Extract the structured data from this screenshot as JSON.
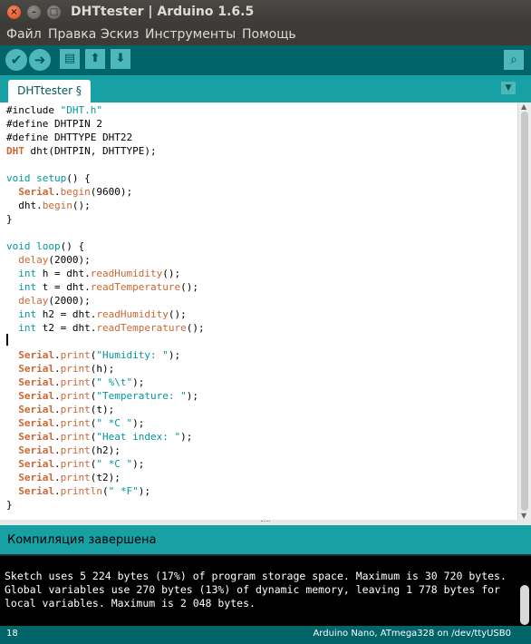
{
  "window": {
    "title": "DHTtester | Arduino 1.6.5",
    "close_glyph": "×",
    "min_glyph": "–",
    "max_glyph": "□"
  },
  "menu": [
    "Файл",
    "Правка",
    "Эскиз",
    "Инструменты",
    "Помощь"
  ],
  "toolbar": {
    "verify_icon": "✔",
    "upload_icon": "➔",
    "new_icon": "▤",
    "open_icon": "⬆",
    "save_icon": "⬇",
    "serial_monitor_icon": "⌕"
  },
  "tab": {
    "label": "DHTtester §",
    "menu_glyph": "▼"
  },
  "editor": {
    "lines": [
      [
        {
          "t": "#include ",
          "c": ""
        },
        {
          "t": "\"DHT.h\"",
          "c": "str"
        }
      ],
      [
        {
          "t": "#define DHTPIN 2",
          "c": ""
        }
      ],
      [
        {
          "t": "#define DHTTYPE DHT22",
          "c": ""
        }
      ],
      [
        {
          "t": "DHT",
          "c": "cls"
        },
        {
          "t": " dht(DHTPIN, DHTTYPE);",
          "c": ""
        }
      ],
      [],
      [
        {
          "t": "void",
          "c": "ty"
        },
        {
          "t": " ",
          "c": ""
        },
        {
          "t": "setup",
          "c": "ty"
        },
        {
          "t": "() {",
          "c": ""
        }
      ],
      [
        {
          "t": "  ",
          "c": ""
        },
        {
          "t": "Serial",
          "c": "cls"
        },
        {
          "t": ".",
          "c": ""
        },
        {
          "t": "begin",
          "c": "fn"
        },
        {
          "t": "(9600);",
          "c": ""
        }
      ],
      [
        {
          "t": "  dht.",
          "c": ""
        },
        {
          "t": "begin",
          "c": "fn"
        },
        {
          "t": "();",
          "c": ""
        }
      ],
      [
        {
          "t": "}",
          "c": ""
        }
      ],
      [],
      [
        {
          "t": "void",
          "c": "ty"
        },
        {
          "t": " ",
          "c": ""
        },
        {
          "t": "loop",
          "c": "ty"
        },
        {
          "t": "() {",
          "c": ""
        }
      ],
      [
        {
          "t": "  ",
          "c": ""
        },
        {
          "t": "delay",
          "c": "fn"
        },
        {
          "t": "(2000);",
          "c": ""
        }
      ],
      [
        {
          "t": "  ",
          "c": ""
        },
        {
          "t": "int",
          "c": "ty"
        },
        {
          "t": " h = dht.",
          "c": ""
        },
        {
          "t": "readHumidity",
          "c": "fn"
        },
        {
          "t": "();",
          "c": ""
        }
      ],
      [
        {
          "t": "  ",
          "c": ""
        },
        {
          "t": "int",
          "c": "ty"
        },
        {
          "t": " t = dht.",
          "c": ""
        },
        {
          "t": "readTemperature",
          "c": "fn"
        },
        {
          "t": "();",
          "c": ""
        }
      ],
      [
        {
          "t": "  ",
          "c": ""
        },
        {
          "t": "delay",
          "c": "fn"
        },
        {
          "t": "(2000);",
          "c": ""
        }
      ],
      [
        {
          "t": "  ",
          "c": ""
        },
        {
          "t": "int",
          "c": "ty"
        },
        {
          "t": " h2 = dht.",
          "c": ""
        },
        {
          "t": "readHumidity",
          "c": "fn"
        },
        {
          "t": "();",
          "c": ""
        }
      ],
      [
        {
          "t": "  ",
          "c": ""
        },
        {
          "t": "int",
          "c": "ty"
        },
        {
          "t": " t2 = dht.",
          "c": ""
        },
        {
          "t": "readTemperature",
          "c": "fn"
        },
        {
          "t": "();",
          "c": ""
        }
      ],
      [],
      [
        {
          "t": "  ",
          "c": ""
        },
        {
          "t": "Serial",
          "c": "cls"
        },
        {
          "t": ".",
          "c": ""
        },
        {
          "t": "print",
          "c": "fn"
        },
        {
          "t": "(",
          "c": ""
        },
        {
          "t": "\"Humidity: \"",
          "c": "str"
        },
        {
          "t": ");",
          "c": ""
        }
      ],
      [
        {
          "t": "  ",
          "c": ""
        },
        {
          "t": "Serial",
          "c": "cls"
        },
        {
          "t": ".",
          "c": ""
        },
        {
          "t": "print",
          "c": "fn"
        },
        {
          "t": "(h);",
          "c": ""
        }
      ],
      [
        {
          "t": "  ",
          "c": ""
        },
        {
          "t": "Serial",
          "c": "cls"
        },
        {
          "t": ".",
          "c": ""
        },
        {
          "t": "print",
          "c": "fn"
        },
        {
          "t": "(",
          "c": ""
        },
        {
          "t": "\" %\\t\"",
          "c": "str"
        },
        {
          "t": ");",
          "c": ""
        }
      ],
      [
        {
          "t": "  ",
          "c": ""
        },
        {
          "t": "Serial",
          "c": "cls"
        },
        {
          "t": ".",
          "c": ""
        },
        {
          "t": "print",
          "c": "fn"
        },
        {
          "t": "(",
          "c": ""
        },
        {
          "t": "\"Temperature: \"",
          "c": "str"
        },
        {
          "t": ");",
          "c": ""
        }
      ],
      [
        {
          "t": "  ",
          "c": ""
        },
        {
          "t": "Serial",
          "c": "cls"
        },
        {
          "t": ".",
          "c": ""
        },
        {
          "t": "print",
          "c": "fn"
        },
        {
          "t": "(t);",
          "c": ""
        }
      ],
      [
        {
          "t": "  ",
          "c": ""
        },
        {
          "t": "Serial",
          "c": "cls"
        },
        {
          "t": ".",
          "c": ""
        },
        {
          "t": "print",
          "c": "fn"
        },
        {
          "t": "(",
          "c": ""
        },
        {
          "t": "\" *C \"",
          "c": "str"
        },
        {
          "t": ");",
          "c": ""
        }
      ],
      [
        {
          "t": "  ",
          "c": ""
        },
        {
          "t": "Serial",
          "c": "cls"
        },
        {
          "t": ".",
          "c": ""
        },
        {
          "t": "print",
          "c": "fn"
        },
        {
          "t": "(",
          "c": ""
        },
        {
          "t": "\"Heat index: \"",
          "c": "str"
        },
        {
          "t": ");",
          "c": ""
        }
      ],
      [
        {
          "t": "  ",
          "c": ""
        },
        {
          "t": "Serial",
          "c": "cls"
        },
        {
          "t": ".",
          "c": ""
        },
        {
          "t": "print",
          "c": "fn"
        },
        {
          "t": "(h2);",
          "c": ""
        }
      ],
      [
        {
          "t": "  ",
          "c": ""
        },
        {
          "t": "Serial",
          "c": "cls"
        },
        {
          "t": ".",
          "c": ""
        },
        {
          "t": "print",
          "c": "fn"
        },
        {
          "t": "(",
          "c": ""
        },
        {
          "t": "\" *C \"",
          "c": "str"
        },
        {
          "t": ");",
          "c": ""
        }
      ],
      [
        {
          "t": "  ",
          "c": ""
        },
        {
          "t": "Serial",
          "c": "cls"
        },
        {
          "t": ".",
          "c": ""
        },
        {
          "t": "print",
          "c": "fn"
        },
        {
          "t": "(t2);",
          "c": ""
        }
      ],
      [
        {
          "t": "  ",
          "c": ""
        },
        {
          "t": "Serial",
          "c": "cls"
        },
        {
          "t": ".",
          "c": ""
        },
        {
          "t": "println",
          "c": "fn"
        },
        {
          "t": "(",
          "c": ""
        },
        {
          "t": "\" *F\"",
          "c": "str"
        },
        {
          "t": ");",
          "c": ""
        }
      ],
      [
        {
          "t": "}",
          "c": ""
        }
      ]
    ]
  },
  "status": {
    "message": "Компиляция завершена"
  },
  "console": {
    "lines": [
      "Sketch uses 5 224 bytes (17%) of program storage space. Maximum is 30 720 bytes.",
      "Global variables use 270 bytes (13%) of dynamic memory, leaving 1 778 bytes for",
      "local variables. Maximum is 2 048 bytes."
    ]
  },
  "footer": {
    "line_number": "18",
    "board": "Arduino Nano, ATmega328 on /dev/ttyUSB0"
  },
  "colors": {
    "toolbar": "#006468",
    "tabbar": "#17a1a5",
    "keyword": "#cc6633",
    "type": "#00979c"
  }
}
